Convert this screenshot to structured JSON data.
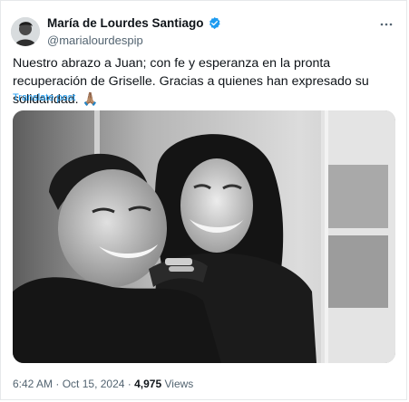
{
  "post": {
    "author_name": "María de Lourdes Santiago",
    "author_handle": "@marialourdespip",
    "text": "Nuestro abrazo a Juan; con fe y esperanza en la pronta recuperación de Griselle. Gracias a quienes han expresado su solidaridad. 🙏🏽",
    "translate_label": "Translate post",
    "time": "6:42 AM",
    "separator": "·",
    "date": "Oct 15, 2024",
    "views_count": "4,975",
    "views_label": "Views"
  },
  "colors": {
    "accent": "#1d9bf0",
    "secondary_text": "#536471",
    "primary_text": "#0f1419"
  },
  "icons": {
    "verified": "verified-badge-icon",
    "more": "more-options-icon"
  }
}
